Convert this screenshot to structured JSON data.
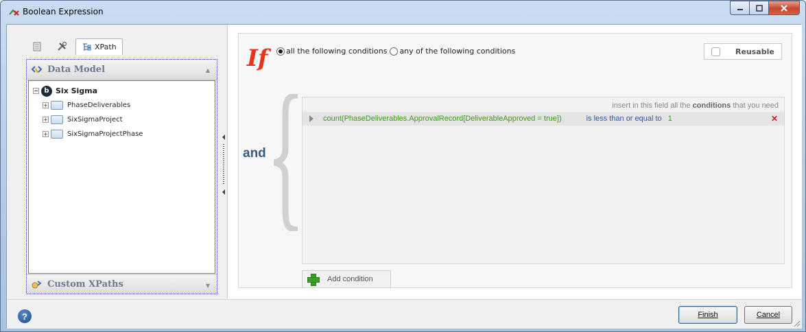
{
  "window": {
    "title": "Boolean Expression",
    "controls": {
      "minimize": "minimize",
      "maximize": "maximize",
      "close": "close"
    }
  },
  "left_panel": {
    "tabs": [
      {
        "icon": "document-icon",
        "label": ""
      },
      {
        "icon": "tools-icon",
        "label": ""
      },
      {
        "icon": "xpath-icon",
        "label": "XPath"
      }
    ],
    "data_model_header": "Data Model",
    "tree": {
      "root": "Six Sigma",
      "children": [
        "PhaseDeliverables",
        "SixSigmaProject",
        "SixSigmaProjectPhase"
      ]
    },
    "custom_xpaths_header": "Custom XPaths"
  },
  "rule": {
    "if_label": "If",
    "option_all": "all the following conditions",
    "option_any": "any of the following conditions",
    "selected_option": "all",
    "reusable_label": "Reusable",
    "and_label": "and",
    "hint_prefix": "insert in this field all the",
    "hint_bold": "conditions",
    "hint_suffix": "that you need",
    "conditions": [
      {
        "expression": "count(PhaseDeliverables.ApprovalRecord[DeliverableApproved = true])",
        "operator": "is less than or equal to",
        "value": "1"
      }
    ],
    "add_condition_label": "Add condition"
  },
  "footer": {
    "help_label": "?",
    "finish_label": "Finish",
    "cancel_label": "Cancel"
  },
  "colors": {
    "if": "#e8341c",
    "expression": "#3f9a1a",
    "operator": "#2c5aa0",
    "delete": "#d01818"
  }
}
